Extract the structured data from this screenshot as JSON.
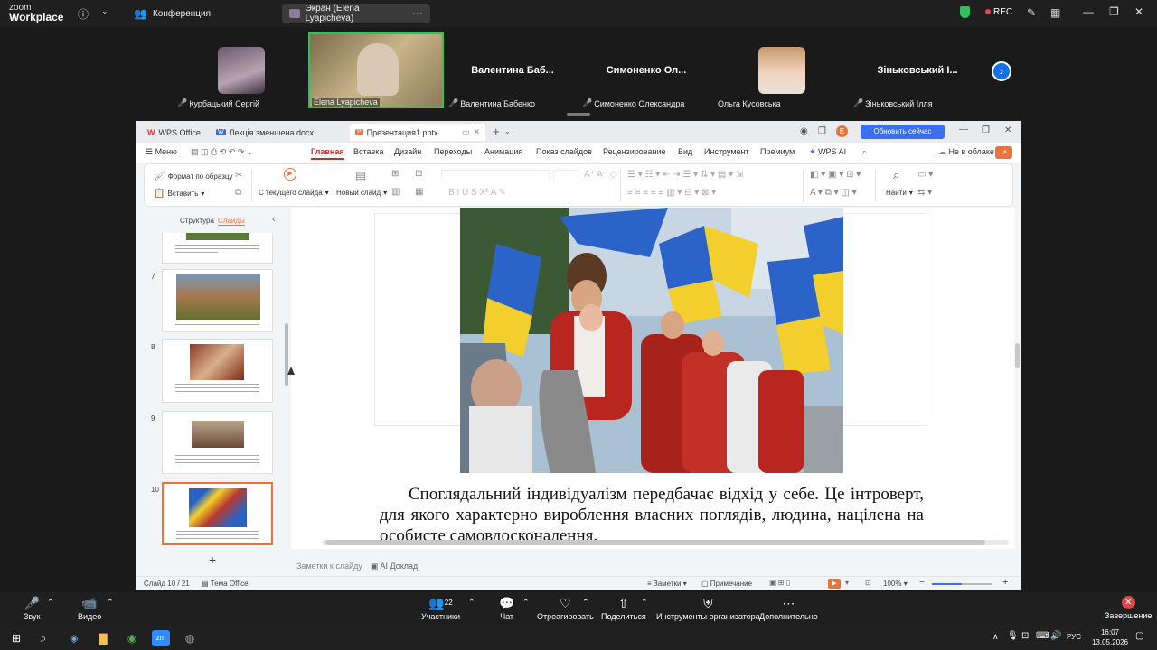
{
  "zoom_top": {
    "logo_line1": "zoom",
    "logo_line2": "Workplace",
    "tab_conference": "Конференция",
    "tab_screen": "Экран (Elena Lyapicheva)",
    "rec_label": "REC"
  },
  "participants": [
    {
      "name_large": "",
      "label": "Курбацький Сергій"
    },
    {
      "name_large": "",
      "label": "Elena Lyapicheva"
    },
    {
      "name_large": "Валентина Баб...",
      "label": "Валентина Бабенко"
    },
    {
      "name_large": "Симоненко Ол...",
      "label": "Симоненко Олександра"
    },
    {
      "name_large": "",
      "label": "Ольга Кусовська"
    },
    {
      "name_large": "Зіньковський І...",
      "label": "Зіньковський Ілля"
    }
  ],
  "wps": {
    "tabs": [
      "WPS Office",
      "Лекція зменшена.docx",
      "Презентация1.pptx"
    ],
    "update_button": "Обновить сейчас",
    "menu_label": "Меню",
    "menu": [
      "Главная",
      "Вставка",
      "Дизайн",
      "Переходы",
      "Анимация",
      "Показ слайдов",
      "Рецензирование",
      "Вид",
      "Инструмент",
      "Премиум",
      "WPS AI"
    ],
    "cloud_label": "Не в облаке",
    "ribbon": {
      "format_painter": "Формат по образцу",
      "paste": "Вставить",
      "from_current": "С текущего слайда",
      "new_slide": "Новый слайд",
      "find": "Найти"
    },
    "panel_tabs": [
      "Структура",
      "Слайды"
    ],
    "slide_numbers": [
      "7",
      "8",
      "9",
      "10"
    ],
    "slide_text": "Споглядальний індивідуалізм передбачає відхід у себе. Це інтроверт, для якого характерно вироблення власних поглядів, людина, націлена на особисте самовдосконалення.",
    "notes_placeholder": "Заметки к слайду",
    "ai_report": "AI Доклад",
    "status_slide": "Слайд 10 / 21",
    "status_theme": "Тема Office",
    "status_notes": "Заметки",
    "status_comment": "Примечание",
    "zoom_level": "100%"
  },
  "zoom_bottom": {
    "audio": "Звук",
    "video": "Видео",
    "participants_count": "22",
    "participants": "Участники",
    "chat": "Чат",
    "react": "Отреагировать",
    "share": "Поделиться",
    "host_tools": "Инструменты организатора",
    "more": "Дополнительно",
    "end": "Завершение"
  },
  "taskbar": {
    "lang": "РУС",
    "time": "16:07",
    "date": "13.05.2026"
  },
  "colors": {
    "accent_red": "#c4322c",
    "zoom_blue": "#0e72ed",
    "selection_orange": "#e8743b"
  }
}
